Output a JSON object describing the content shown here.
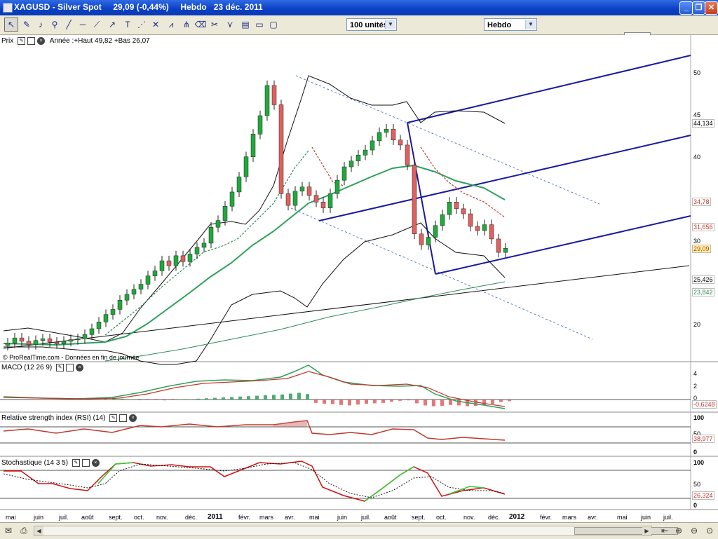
{
  "window": {
    "title": "XAGUSD - Silver Spot",
    "price": "29,09 (-0,44%)",
    "period": "Hebdo",
    "date": "23 déc. 2011",
    "buttons": [
      "_",
      "❐",
      "✕"
    ]
  },
  "toolbar": {
    "units_combo": "100 unités",
    "period_combo": "Hebdo",
    "tools": [
      "pointer",
      "ruler",
      "alarm",
      "zoom",
      "line",
      "hline",
      "trendline",
      "text",
      "fibonacci",
      "cross",
      "channel",
      "eraser",
      "delete",
      "fan",
      "grid",
      "rectangle",
      "capture"
    ]
  },
  "panels": {
    "price": {
      "label": "Prix",
      "info": "Année :+Haut 49,82 +Bas 26,07",
      "axis_labels": [
        "50",
        "45",
        "40",
        "30",
        "20"
      ],
      "values": [
        {
          "text": "44,134",
          "color": "#000000"
        },
        {
          "text": "34,78",
          "color": "#c0392b"
        },
        {
          "text": "31,656",
          "color": "#c0392b"
        },
        {
          "text": "29,09",
          "color": "#c0392b"
        },
        {
          "text": "25,426",
          "color": "#000000"
        },
        {
          "text": "23,842",
          "color": "#2e8b57"
        }
      ]
    },
    "macd": {
      "label": "MACD (12 26 9)",
      "axis_labels": [
        "4",
        "2",
        "0"
      ],
      "value": "-0,6248"
    },
    "rsi": {
      "label": "Relative strength index (RSI) (14)",
      "axis_labels": [
        "100",
        "50",
        "0"
      ],
      "value": "38,977"
    },
    "stoch": {
      "label": "Stochastique (14 3 5)",
      "axis_labels": [
        "100",
        "50",
        "0"
      ],
      "value": "26,324"
    }
  },
  "watermark": "© ProRealTime.com - Données en fin de journée",
  "x_axis": [
    "mai",
    "juin",
    "juil.",
    "août",
    "sept.",
    "oct.",
    "nov.",
    "déc.",
    "2011",
    "févr.",
    "mars",
    "avr.",
    "mai",
    "juin",
    "juil.",
    "août",
    "sept.",
    "oct.",
    "nov.",
    "déc.",
    "2012",
    "févr.",
    "mars",
    "avr.",
    "mai",
    "juin",
    "juil."
  ],
  "bottom": {
    "icons": [
      "mail",
      "print",
      "scroll-left",
      "zoom-in",
      "zoom-out"
    ]
  },
  "colors": {
    "up": "#1faa3c",
    "down": "#e06060",
    "pitchfork": "#1a1aa0",
    "ma": "#2e8b57",
    "accent_title": "#0a3fc4"
  },
  "chart_data": {
    "type": "candlestick",
    "title": "XAGUSD - Silver Spot",
    "ylim": [
      17,
      53
    ],
    "closes": [
      17.8,
      18.4,
      18.0,
      17.6,
      18.1,
      18.3,
      17.9,
      17.7,
      18.0,
      18.2,
      18.3,
      18.8,
      19.5,
      20.3,
      21.2,
      21.8,
      22.9,
      23.6,
      24.2,
      24.8,
      25.8,
      26.4,
      27.6,
      27.0,
      28.2,
      27.5,
      28.4,
      29.2,
      29.7,
      31.6,
      32.4,
      34.1,
      35.8,
      37.6,
      40.0,
      42.7,
      44.9,
      48.5,
      46.2,
      35.6,
      34.2,
      35.9,
      36.4,
      35.4,
      34.6,
      33.9,
      35.6,
      37.2,
      38.8,
      39.5,
      40.2,
      40.8,
      41.9,
      42.9,
      43.3,
      42.0,
      41.4,
      39.0,
      30.8,
      29.5,
      30.4,
      31.8,
      33.1,
      34.6,
      33.8,
      33.2,
      31.7,
      31.2,
      31.9,
      30.2,
      28.6,
      29.09
    ],
    "indicators": [
      "Bollinger",
      "MA20",
      "MA50",
      "Pitchfork",
      "MACD",
      "RSI",
      "Stochastique"
    ]
  }
}
